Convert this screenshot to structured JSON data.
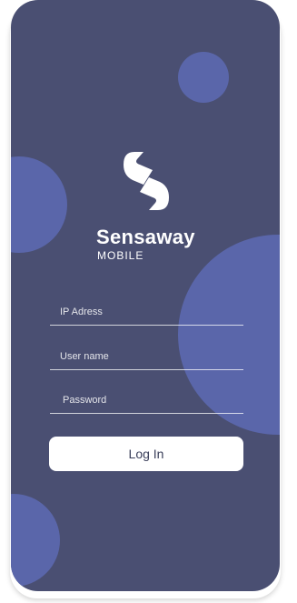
{
  "brand": {
    "name": "Sensaway",
    "subtitle": "MOBILE",
    "logo_icon": "sensaway-s-logo-icon"
  },
  "form": {
    "ip_placeholder": "IP Adress",
    "username_placeholder": "User name",
    "password_placeholder": "Password",
    "login_label": "Log In"
  },
  "colors": {
    "background": "#4a4f72",
    "circle_accent": "#5a66aa",
    "button_bg": "#ffffff",
    "button_text": "#3a3f5a"
  }
}
